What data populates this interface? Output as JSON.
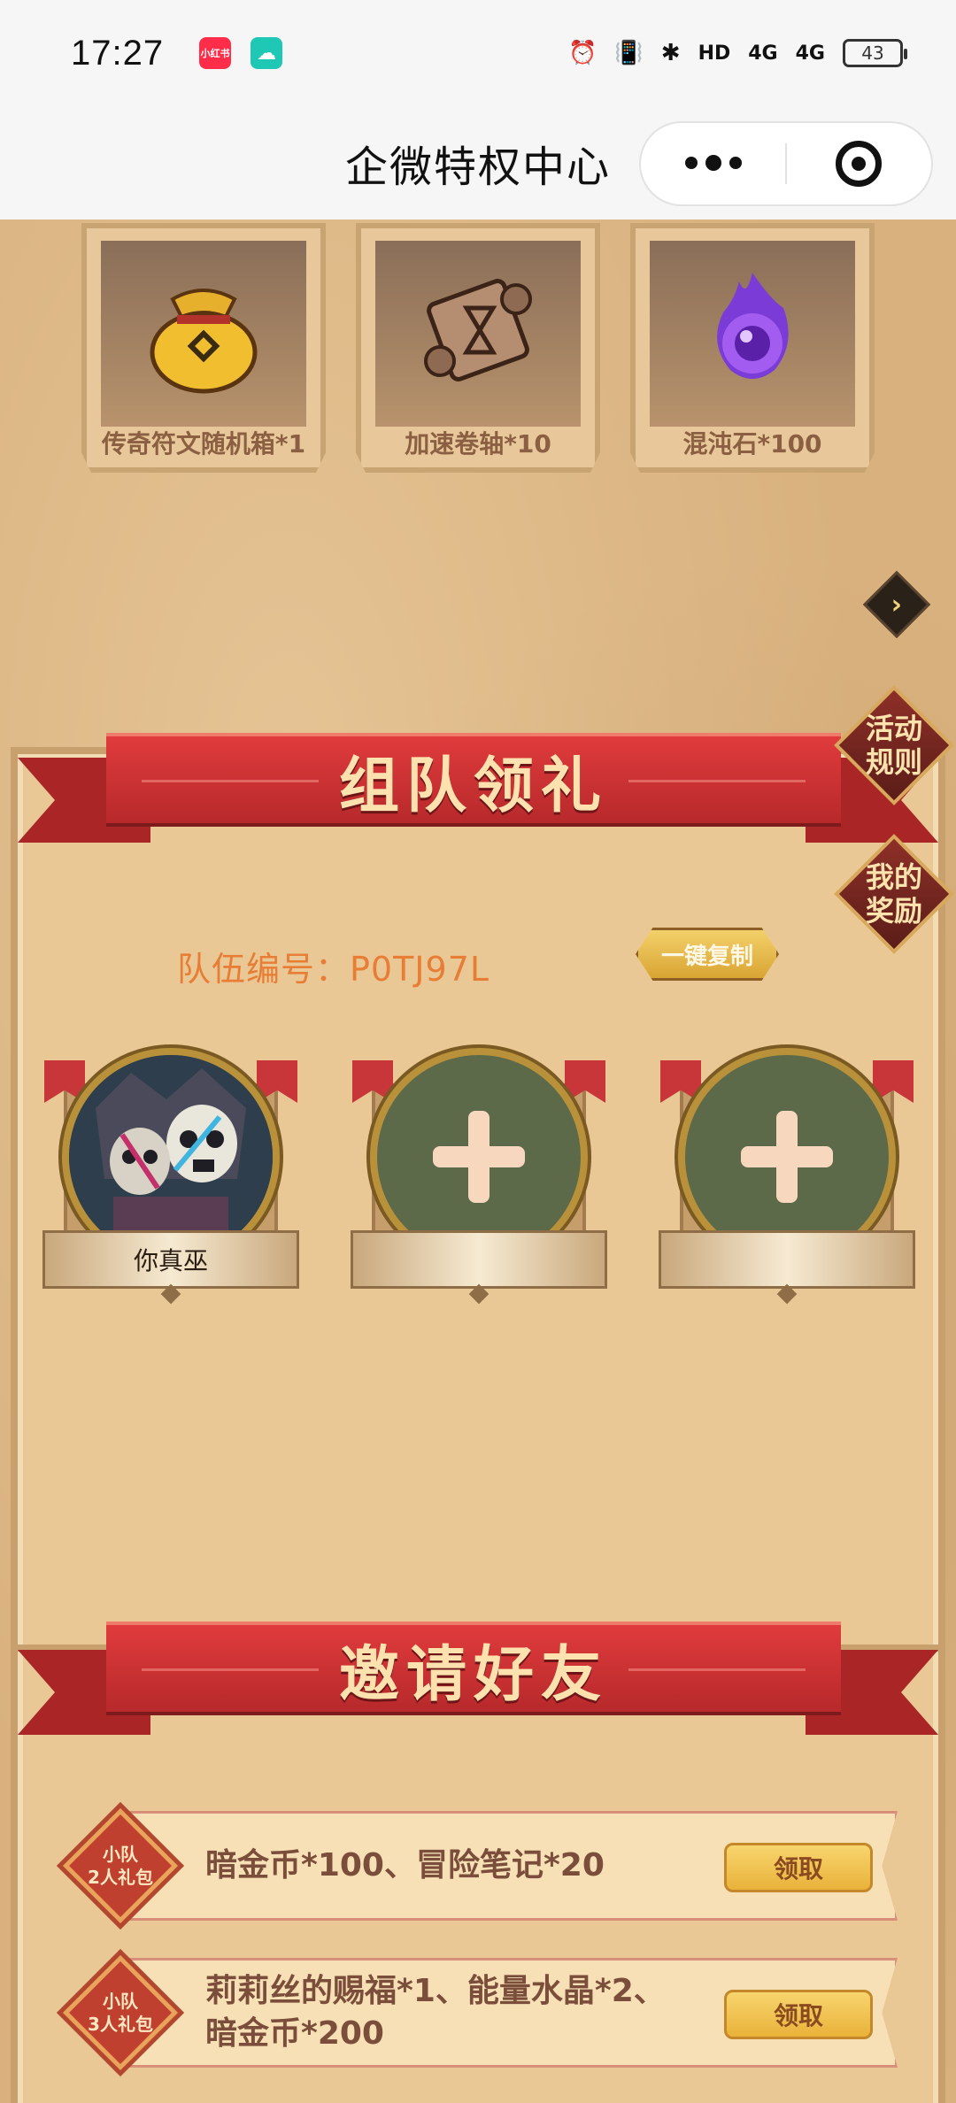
{
  "status_bar": {
    "time": "17:27",
    "app_icon_1": "小红书",
    "app_icon_2": "☁",
    "hd": "HD",
    "signal_1": "4G",
    "signal_2": "4G",
    "battery": "43"
  },
  "nav": {
    "title": "企微特权中心"
  },
  "rewards": [
    {
      "label": "传奇符文随机箱*1",
      "icon": "gold-pouch-icon"
    },
    {
      "label": "加速卷轴*10",
      "icon": "scroll-hourglass-icon"
    },
    {
      "label": "混沌石*100",
      "icon": "purple-orb-icon"
    }
  ],
  "side_buttons": {
    "rules": "活动规则",
    "my_rewards": "我的奖励"
  },
  "team": {
    "banner_title": "组队领礼",
    "team_label": "队伍编号：P0TJ97L",
    "copy_button": "一键复制",
    "members": [
      {
        "name": "你真巫",
        "filled": true
      },
      {
        "name": "",
        "filled": false
      },
      {
        "name": "",
        "filled": false
      }
    ]
  },
  "invite": {
    "banner_title": "邀请好友",
    "gifts": [
      {
        "badge_line1": "小队",
        "badge_line2": "2人礼包",
        "desc": "暗金币*100、冒险笔记*20",
        "button": "领取"
      },
      {
        "badge_line1": "小队",
        "badge_line2": "3人礼包",
        "desc": "莉莉丝的赐福*1、能量水晶*2、暗金币*200",
        "button": "领取"
      }
    ]
  },
  "colors": {
    "banner_red": "#c8363a",
    "parchment": "#e9c896",
    "accent_orange": "#e87d36",
    "button_gold": "#f3d06a"
  }
}
